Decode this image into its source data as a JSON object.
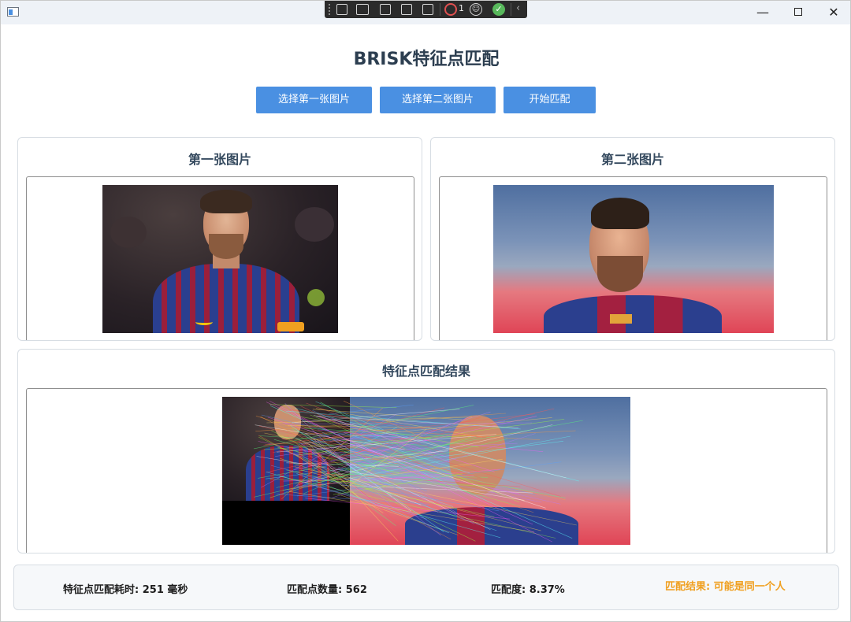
{
  "window": {
    "minimize_glyph": "—",
    "close_glyph": "✕"
  },
  "devbar": {
    "record_count": "1",
    "icons": [
      "select-element-icon",
      "video-icon",
      "pointer-icon",
      "layout-icon",
      "hot-reload-icon",
      "record-icon",
      "accessibility-icon",
      "check-icon",
      "chevron-left-icon"
    ]
  },
  "page": {
    "title": "BRISK特征点匹配"
  },
  "toolbar": {
    "select_first": "选择第一张图片",
    "select_second": "选择第二张图片",
    "start_match": "开始匹配"
  },
  "panels": {
    "first_title": "第一张图片",
    "second_title": "第二张图片",
    "result_title": "特征点匹配结果"
  },
  "status": {
    "time": "特征点匹配耗时: 251 毫秒",
    "count": "匹配点数量: 562",
    "score": "匹配度: 8.37%",
    "result": "匹配结果: 可能是同一个人"
  },
  "colors": {
    "button": "#4a90e2",
    "result_text": "#f0a020",
    "title": "#2c3e50"
  }
}
